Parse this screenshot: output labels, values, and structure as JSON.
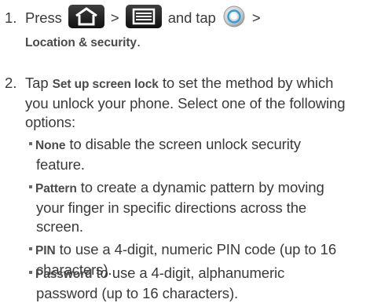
{
  "step1": {
    "number": "1.",
    "press": "Press",
    "sep1": ">",
    "sep2": "and tap",
    "sep3": ">",
    "location_security": "Location & security",
    "period": ".",
    "icons": [
      "home-icon",
      "menu-icon",
      "settings-icon"
    ]
  },
  "step2": {
    "number": "2.",
    "tap": "Tap",
    "set_up_screen_lock": "Set up screen lock",
    "line1_rest": "to set the method by which",
    "line2": "you unlock your phone. Select one of the following",
    "line3": "options:"
  },
  "options": [
    {
      "label": "None",
      "l1": "to disable the screen unlock security",
      "l2": "feature.",
      "l3": ""
    },
    {
      "label": "Pattern",
      "l1": "to create a dynamic pattern by moving",
      "l2": "your finger in specific directions across the",
      "l3": "screen."
    },
    {
      "label": "PIN",
      "l1": "to use a 4-digit, numeric PIN code (up to 16",
      "l2": "characters).",
      "l3": ""
    },
    {
      "label": "Password",
      "l1": "to use a 4-digit, alphanumeric",
      "l2": "password (up to 16 characters).",
      "l3": ""
    }
  ],
  "colors": {
    "text": "#3a3a3a",
    "icon_bg": "#1a1a1a",
    "icon_fg": "#ffffff"
  }
}
